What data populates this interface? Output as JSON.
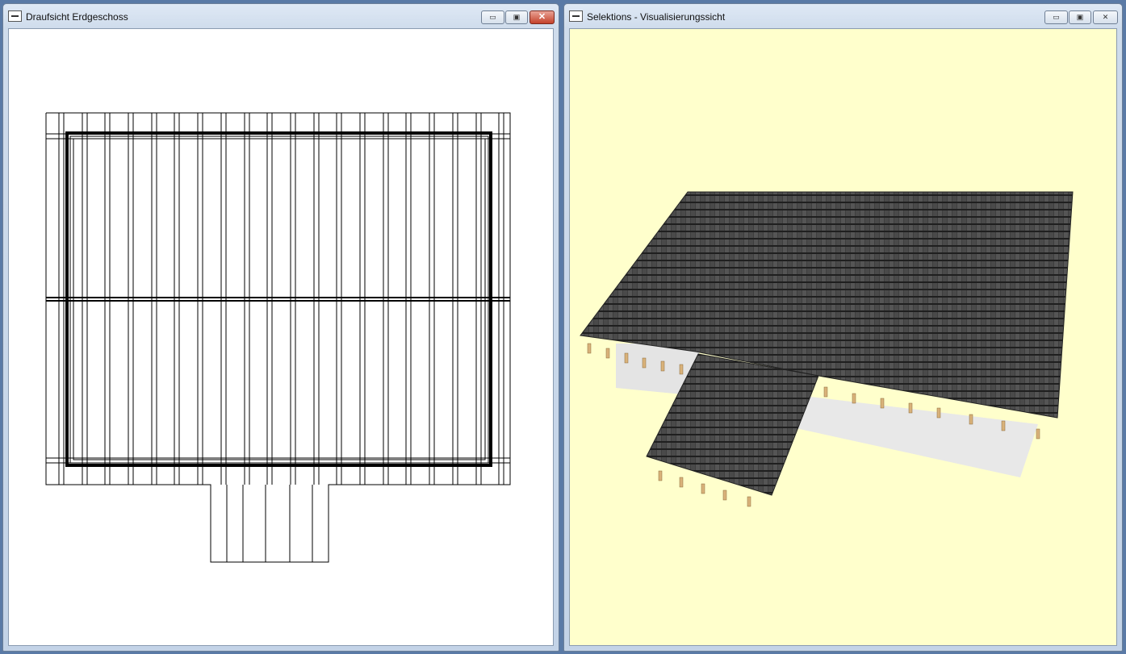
{
  "windows": [
    {
      "title": "Draufsicht Erdgeschoss",
      "view": "floor-plan",
      "buttons": {
        "minimize": "▭",
        "maximize": "▣",
        "close": "✕"
      }
    },
    {
      "title": "Selektions - Visualisierungssicht",
      "view": "3d-visualization",
      "buttons": {
        "minimize": "▭",
        "maximize": "▣",
        "close": "✕"
      }
    }
  ],
  "colors": {
    "floor_plan_bg": "#ffffff",
    "visualization_bg": "#ffffcc",
    "roof_tiles": "#3e3e3e",
    "rafter_ends": "#d9b27a",
    "wall": "#e6e6e6"
  }
}
